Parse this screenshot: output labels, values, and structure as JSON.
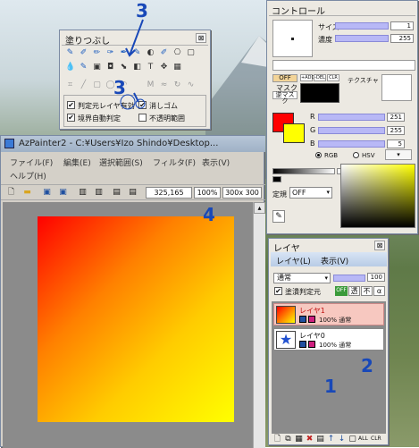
{
  "annotations": [
    "3",
    "3",
    "4",
    "2",
    "1"
  ],
  "fill_panel": {
    "title": "塗りつぶし",
    "options": [
      "判定元レイヤ有効",
      "境界自動判定",
      "消しゴム",
      "不透明範囲"
    ]
  },
  "control_panel": {
    "title": "コントロール",
    "size_label": "サイズ",
    "size_value": "1",
    "density_label": "濃度",
    "density_value": "255",
    "mask_off": "OFF",
    "mask_label": "マスク",
    "mask_reverse": "逆マスク",
    "mask_buttons": [
      "+ADD",
      "-DEL",
      "CLR"
    ],
    "texture_label": "テクスチャ",
    "r_label": "R",
    "r_value": "251",
    "g_label": "G",
    "g_value": "255",
    "b_label": "B",
    "b_value": "5",
    "rgb_label": "RGB",
    "hsv_label": "HSV",
    "rule_label": "定規",
    "rule_value": "OFF",
    "colors": {
      "foreground": "#ff0000",
      "background": "#ffff00"
    }
  },
  "main_window": {
    "title": "AzPainter2 - C:¥Users¥Izo Shindo¥Desktop...",
    "menu": [
      "ファイル(F)",
      "編集(E)",
      "選択範囲(S)",
      "フィルタ(F)",
      "表示(V)",
      "ヘルプ(H)"
    ],
    "coords": "325,165",
    "zoom": "100%",
    "canvas_size": "300x 300"
  },
  "layer_panel": {
    "title": "レイヤ",
    "menu": [
      "レイヤ(L)",
      "表示(V)"
    ],
    "blend_mode": "通常",
    "opacity": "100",
    "paint_judge_label": "塗潰判定元",
    "off_btn": "OFF",
    "toggle_labels": [
      "透",
      "不",
      "α"
    ],
    "layers": [
      {
        "name": "レイヤ1",
        "info": "100% 通常"
      },
      {
        "name": "レイヤ0",
        "info": "100% 通常"
      }
    ],
    "bottom_labels": [
      "ALL",
      "CLR"
    ]
  }
}
